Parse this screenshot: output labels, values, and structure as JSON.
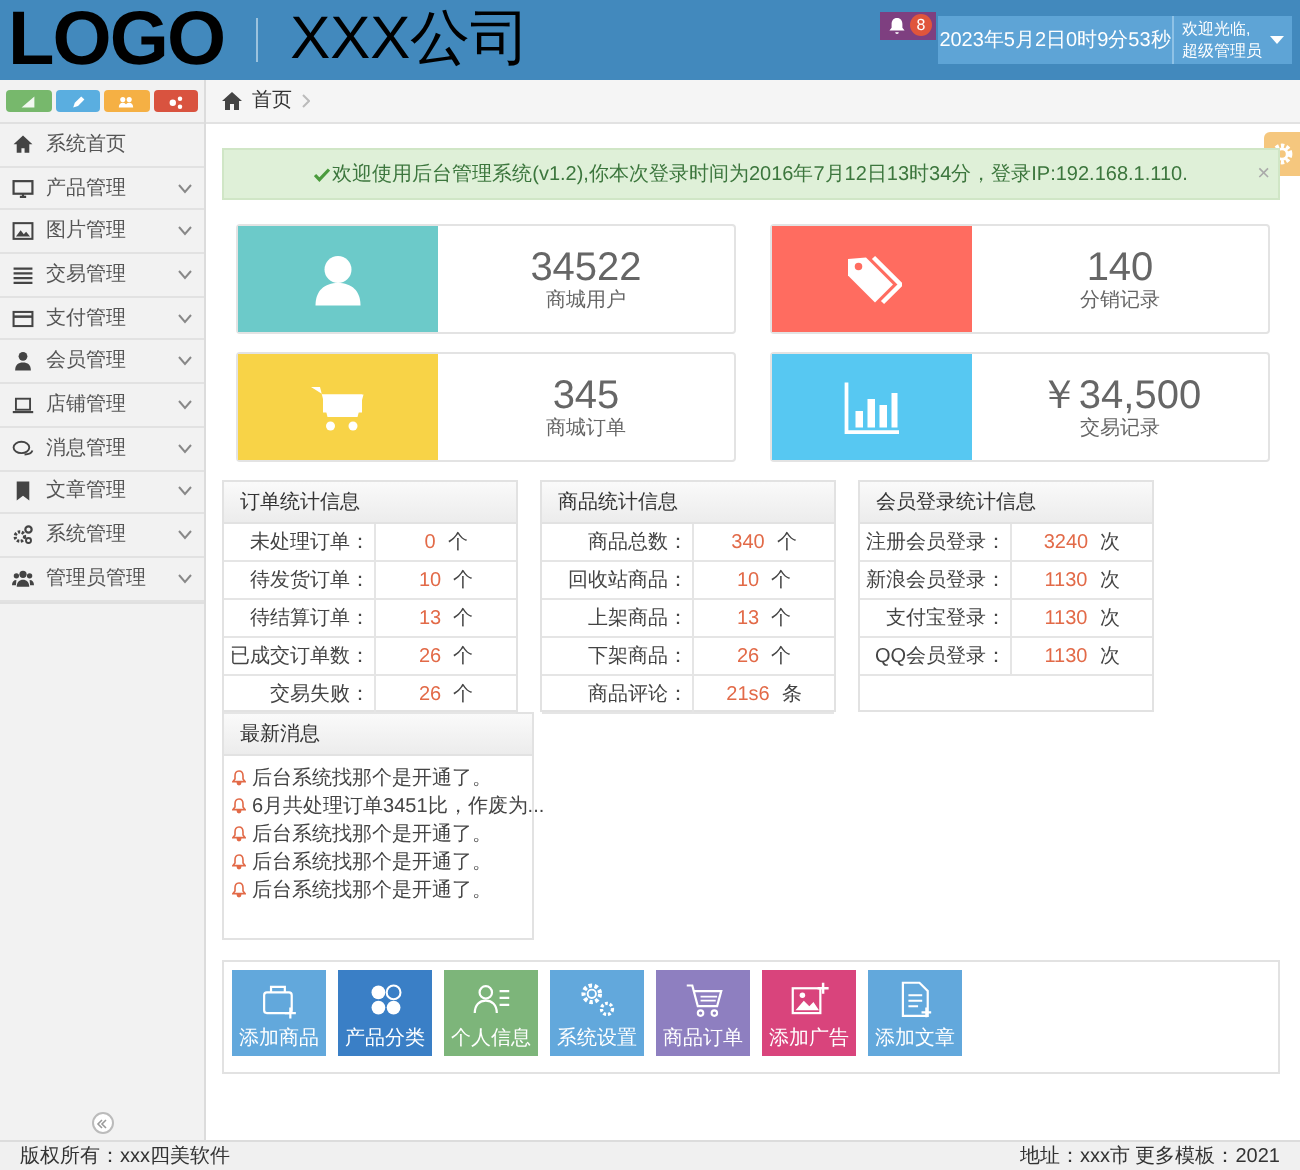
{
  "header": {
    "logo": "LOGO",
    "company": "XXX公司",
    "notification_count": "8",
    "datetime": "2023年5月2日0时9分53秒",
    "welcome": "欢迎光临,",
    "user": "超级管理员"
  },
  "sidebar": {
    "shortcuts": [
      {
        "color": "#77b86c"
      },
      {
        "color": "#5aaee0"
      },
      {
        "color": "#f5b044"
      },
      {
        "color": "#d9533f"
      }
    ],
    "items": [
      {
        "kind": "link",
        "label": "系统首页"
      },
      {
        "kind": "group",
        "label": "产品管理",
        "expanded": false
      },
      {
        "kind": "group",
        "label": "图片管理",
        "expanded": false
      },
      {
        "kind": "group",
        "label": "交易管理",
        "expanded": false
      },
      {
        "kind": "group",
        "label": "支付管理",
        "expanded": false
      },
      {
        "kind": "group",
        "label": "会员管理",
        "expanded": false
      },
      {
        "kind": "group",
        "label": "店铺管理",
        "expanded": false
      },
      {
        "kind": "group",
        "label": "消息管理",
        "expanded": false
      },
      {
        "kind": "group",
        "label": "文章管理",
        "expanded": false
      },
      {
        "kind": "group",
        "label": "系统管理",
        "expanded": false
      },
      {
        "kind": "group",
        "label": "管理员管理",
        "expanded": false
      }
    ]
  },
  "breadcrumb": [
    "首页"
  ],
  "alert": {
    "text": "欢迎使用后台管理系统(v1.2),你本次登录时间为2016年7月12日13时34分，登录IP:192.168.1.110.",
    "close": "×"
  },
  "stats": [
    {
      "color": "#6ccac9",
      "value": "34522",
      "label": "商城用户"
    },
    {
      "color": "#ff6c60",
      "value": "140",
      "label": "分销记录"
    },
    {
      "color": "#f8d347",
      "value": "345",
      "label": "商城订单"
    },
    {
      "color": "#57c8f2",
      "value": "￥34,500",
      "label": "交易记录"
    }
  ],
  "tables": [
    {
      "title": "订单统计信息",
      "rows": [
        {
          "label": "未处理订单：",
          "value": "0",
          "unit": "个"
        },
        {
          "label": "待发货订单：",
          "value": "10",
          "unit": "个"
        },
        {
          "label": "待结算订单：",
          "value": "13",
          "unit": "个"
        },
        {
          "label": "已成交订单数：",
          "value": "26",
          "unit": "个"
        },
        {
          "label": "交易失败：",
          "value": "26",
          "unit": "个"
        }
      ]
    },
    {
      "title": "商品统计信息",
      "rows": [
        {
          "label": "商品总数：",
          "value": "340",
          "unit": "个"
        },
        {
          "label": "回收站商品：",
          "value": "10",
          "unit": "个"
        },
        {
          "label": "上架商品：",
          "value": "13",
          "unit": "个"
        },
        {
          "label": "下架商品：",
          "value": "26",
          "unit": "个"
        },
        {
          "label": "商品评论：",
          "value": "21s6",
          "unit": "条"
        }
      ]
    },
    {
      "title": "会员登录统计信息",
      "rows": [
        {
          "label": "注册会员登录：",
          "value": "3240",
          "unit": "次"
        },
        {
          "label": "新浪会员登录：",
          "value": "1130",
          "unit": "次"
        },
        {
          "label": "支付宝登录：",
          "value": "1130",
          "unit": "次"
        },
        {
          "label": "QQ会员登录：",
          "value": "1130",
          "unit": "次"
        }
      ]
    }
  ],
  "news": {
    "title": "最新消息",
    "items": [
      "后台系统找那个是开通了。",
      "6月共处理订单3451比，作废为...",
      "后台系统找那个是开通了。",
      "后台系统找那个是开通了。",
      "后台系统找那个是开通了。"
    ]
  },
  "quick_actions": [
    {
      "label": "添加商品",
      "color": "#62a8dc"
    },
    {
      "label": "产品分类",
      "color": "#3a7fc6"
    },
    {
      "label": "个人信息",
      "color": "#7db57a"
    },
    {
      "label": "系统设置",
      "color": "#62a8dc"
    },
    {
      "label": "商品订单",
      "color": "#8e7fc0"
    },
    {
      "label": "添加广告",
      "color": "#d9447c"
    },
    {
      "label": "添加文章",
      "color": "#62a8dc"
    }
  ],
  "footer": {
    "copyright": "版权所有：xxx四美软件",
    "info": "地址：xxx市 更多模板：2021"
  }
}
